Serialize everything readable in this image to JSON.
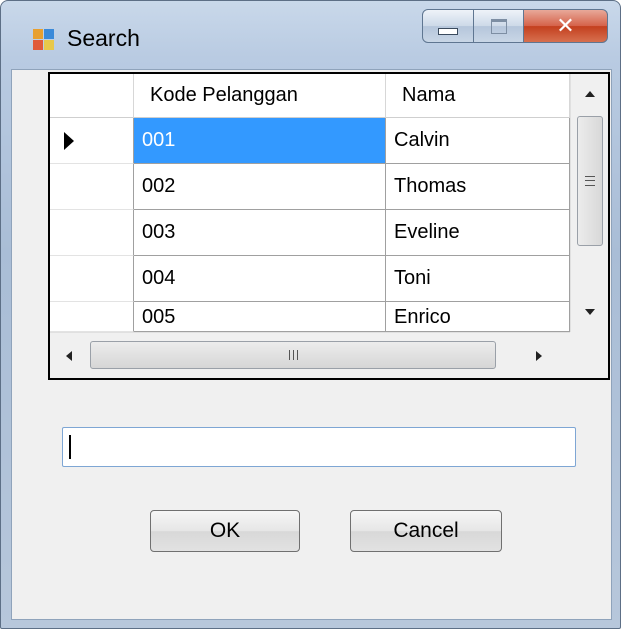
{
  "window": {
    "title": "Search",
    "icon": "app-window-icon",
    "controls": [
      "minimize-icon",
      "maximize-icon",
      "close-icon"
    ],
    "colors": {
      "frame": "#b9cbe2",
      "close": "#c33f1e"
    }
  },
  "grid": {
    "columns": [
      "Kode Pelanggan",
      "Nama"
    ],
    "rows": [
      {
        "kode": "001",
        "nama": "Calvin",
        "selected": true
      },
      {
        "kode": "002",
        "nama": "Thomas",
        "selected": false
      },
      {
        "kode": "003",
        "nama": "Eveline",
        "selected": false
      },
      {
        "kode": "004",
        "nama": "Toni",
        "selected": false
      },
      {
        "kode": "005",
        "nama": "Enrico",
        "selected": false
      }
    ],
    "current_row_indicator": "row-pointer-icon",
    "selection_color": "#3399ff"
  },
  "search": {
    "value": "",
    "placeholder": ""
  },
  "buttons": {
    "ok": "OK",
    "cancel": "Cancel"
  }
}
